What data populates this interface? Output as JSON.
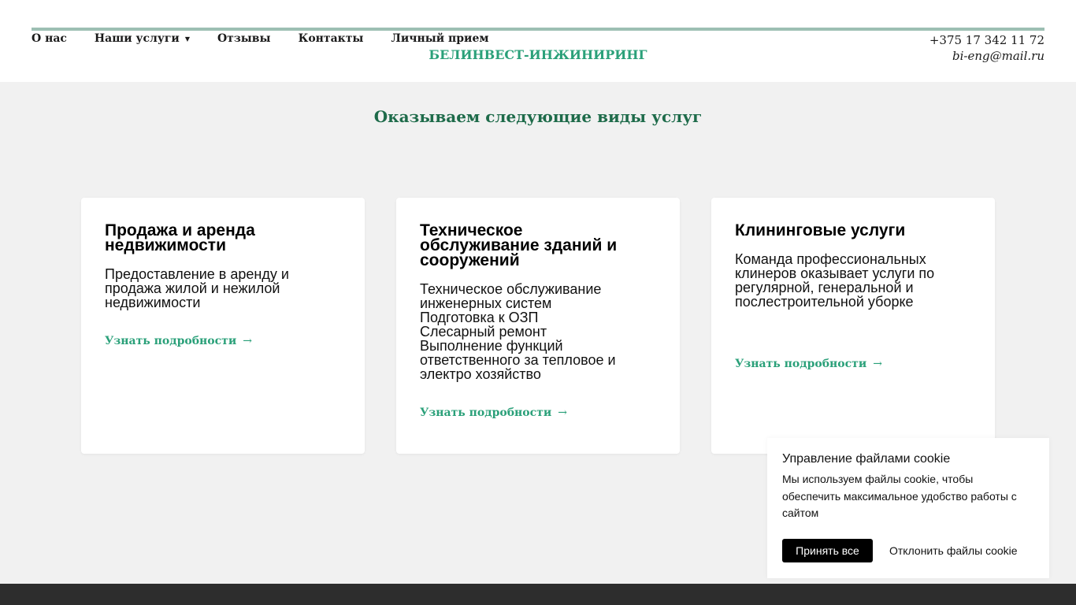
{
  "header": {
    "nav": [
      {
        "label": "О нас"
      },
      {
        "label": "Наши услуги",
        "has_dropdown": true
      },
      {
        "label": "Отзывы"
      },
      {
        "label": "Контакты"
      },
      {
        "label": "Личный прием"
      }
    ],
    "brand": "БЕЛИНВЕСТ-ИНЖИНИРИНГ",
    "phone": "+375 17 342 11 72",
    "email": "bi-eng@mail.ru",
    "accent_line_color": "#9dbfb3"
  },
  "services": {
    "title": "Оказываем следующие виды услуг",
    "cards": [
      {
        "title_lines": [
          "Продажа и аренда",
          "недвижимости"
        ],
        "desc_lines": [
          "Предоставление в аренду и",
          "продажа жилой и нежилой",
          "недвижимости"
        ],
        "link": "Узнать подробности",
        "arrow": "→"
      },
      {
        "title_lines": [
          "Техническое",
          "обслуживание зданий и",
          "сооружений"
        ],
        "desc_lines": [
          "Техническое обслуживание",
          "инженерных систем",
          "Подготовка к ОЗП",
          "Слесарный ремонт",
          "Выполнение функций",
          "ответственного за тепловое и",
          "электро хозяйство"
        ],
        "link": "Узнать подробности",
        "arrow": "→"
      },
      {
        "title_lines": [
          "Клининговые услуги"
        ],
        "desc_lines": [
          "Команда профессиональных",
          "клинеров оказывает услуги по",
          "регулярной, генеральной и",
          "послестроительной уборке"
        ],
        "link": "Узнать подробности",
        "arrow": "→"
      }
    ]
  },
  "cookie": {
    "title": "Управление файлами cookie",
    "text": "Мы используем файлы cookie, чтобы обеспечить максимальное удобство работы с сайтом",
    "accept": "Принять все",
    "decline": "Отклонить файлы cookie"
  },
  "colors": {
    "brand_green": "#2aa079",
    "title_green": "#1e6b4a",
    "background": "#f1f1f1",
    "footer": "#2d2d2d"
  }
}
